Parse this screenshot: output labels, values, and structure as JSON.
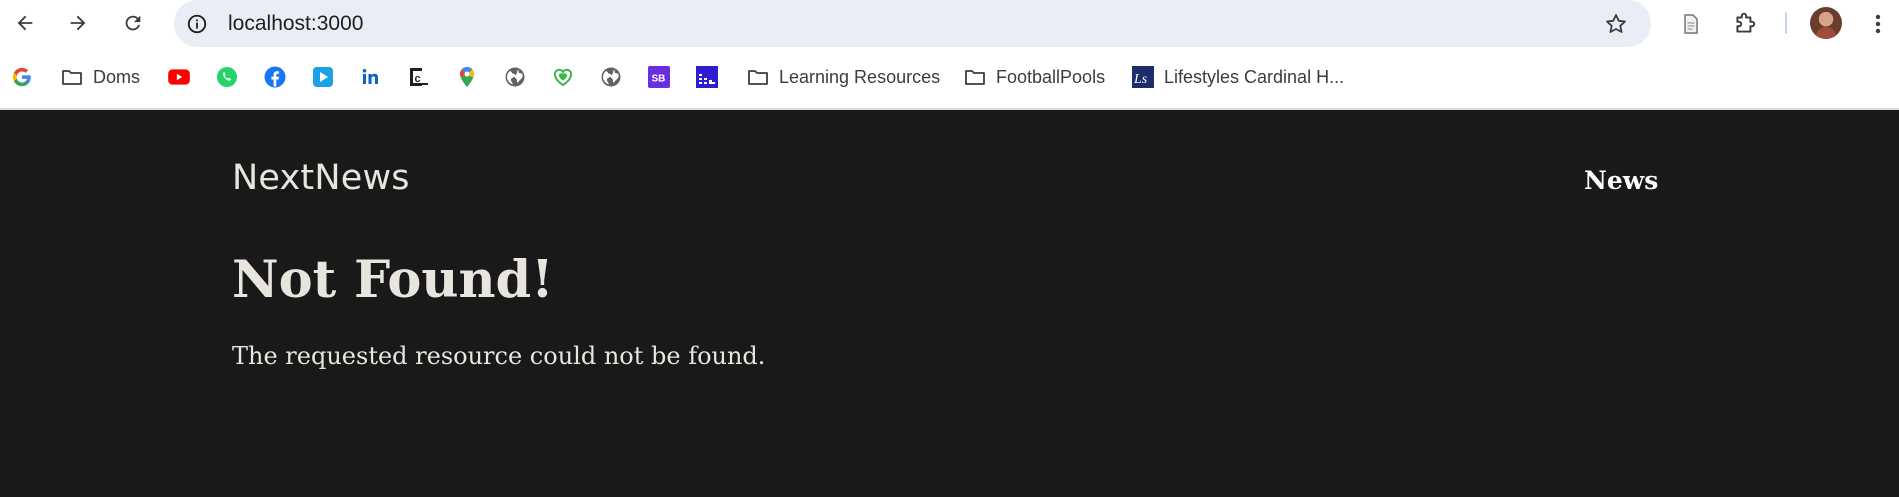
{
  "browser": {
    "address_bar": {
      "url": "localhost:3000"
    },
    "bookmarks": [
      {
        "icon": "google-icon",
        "label": ""
      },
      {
        "icon": "folder-icon",
        "label": "Doms"
      },
      {
        "icon": "youtube-icon",
        "label": ""
      },
      {
        "icon": "whatsapp-icon",
        "label": ""
      },
      {
        "icon": "facebook-icon",
        "label": ""
      },
      {
        "icon": "play-icon",
        "label": ""
      },
      {
        "icon": "linkedin-icon",
        "label": ""
      },
      {
        "icon": "c-code-icon",
        "label": ""
      },
      {
        "icon": "maps-pin-icon",
        "label": ""
      },
      {
        "icon": "globe-icon",
        "label": ""
      },
      {
        "icon": "heart-shield-icon",
        "label": ""
      },
      {
        "icon": "globe-icon",
        "label": ""
      },
      {
        "icon": "sb-icon",
        "label": ""
      },
      {
        "icon": "sheet-icon",
        "label": ""
      },
      {
        "icon": "folder-icon",
        "label": "Learning Resources"
      },
      {
        "icon": "folder-icon",
        "label": "FootballPools"
      },
      {
        "icon": "ls-logo-icon",
        "label": "Lifestyles Cardinal H..."
      }
    ],
    "colors": {
      "omnibox": "#e9eef6",
      "toolbar": "#ffffff"
    }
  },
  "site": {
    "brand": "NextNews",
    "nav": {
      "news_label": "News"
    },
    "heading": "Not Found!",
    "message": "The requested resource could not be found.",
    "colors": {
      "background": "#191919",
      "text": "#e8e4de"
    }
  }
}
